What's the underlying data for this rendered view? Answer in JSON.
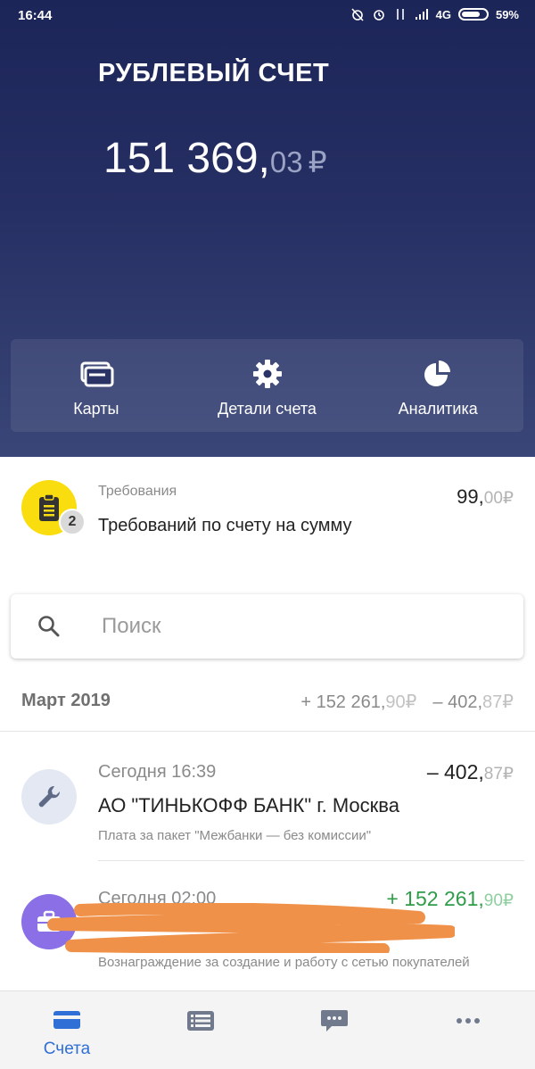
{
  "status_bar": {
    "time": "16:44",
    "network": "4G",
    "battery": "59%"
  },
  "account": {
    "title": "РУБЛЕВЫЙ СЧЕТ",
    "balance_main": "151 369,",
    "balance_cents": "03",
    "currency": "₽"
  },
  "actions": [
    {
      "label": "Карты",
      "icon": "cards-icon"
    },
    {
      "label": "Детали счета",
      "icon": "gear-icon"
    },
    {
      "label": "Аналитика",
      "icon": "pie-chart-icon"
    }
  ],
  "requirement": {
    "category": "Требования",
    "title": "Требований по счету на сумму",
    "badge": "2",
    "amount_main": "99,",
    "amount_cents": "00",
    "currency": "₽",
    "icon": "clipboard-icon",
    "icon_color": "#f9dd0f"
  },
  "search": {
    "placeholder": "Поиск"
  },
  "month_summary": {
    "month": "Март 2019",
    "income_main": "+ 152 261,",
    "income_cents": "90",
    "expense_main": "– 402,",
    "expense_cents": "87",
    "currency": "₽"
  },
  "transactions": [
    {
      "time": "Сегодня 16:39",
      "title": "АО \"ТИНЬКОФФ БАНК\" г. Москва",
      "description": "Плата за пакет \"Межбанки — без комиссии\"",
      "amount_main": "– 402,",
      "amount_cents": "87",
      "currency": "₽",
      "icon": "wrench-icon",
      "icon_bg": "#e3e8f2"
    },
    {
      "time": "Сегодня 02:00",
      "title": "",
      "description": "Вознаграждение за создание и работу с сетью покупателей",
      "amount_main": "+ 152 261,",
      "amount_cents": "90",
      "currency": "₽",
      "icon": "briefcase-icon",
      "icon_bg": "#8b6fe6"
    }
  ],
  "bottom_nav": [
    {
      "label": "Счета",
      "icon": "accounts-card-icon",
      "active": true
    },
    {
      "label": "",
      "icon": "list-icon",
      "active": false
    },
    {
      "label": "",
      "icon": "chat-icon",
      "active": false
    },
    {
      "label": "",
      "icon": "more-icon",
      "active": false
    }
  ],
  "colors": {
    "header_top": "#1c2558",
    "accent_blue": "#2f6fd6",
    "positive_green": "#2f9c4a"
  }
}
